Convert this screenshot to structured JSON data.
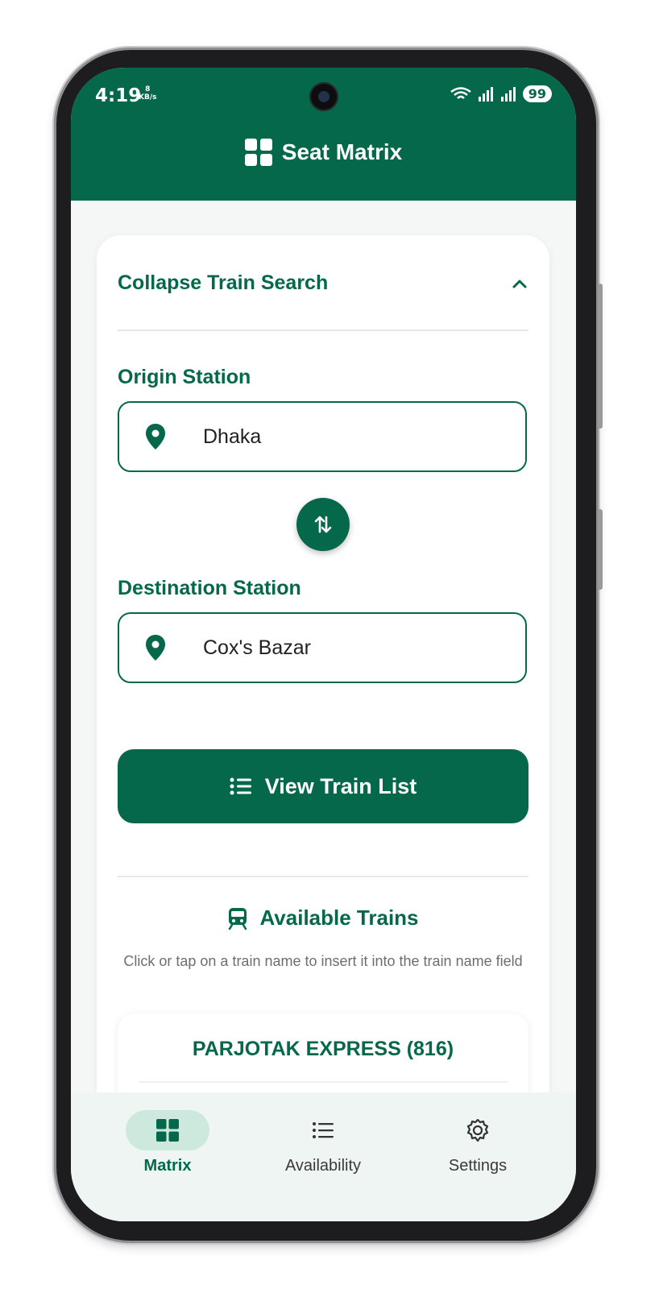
{
  "status_bar": {
    "time": "4:19",
    "speed_value": "8",
    "speed_unit": "KB/s",
    "battery": "99"
  },
  "app": {
    "title": "Seat Matrix"
  },
  "search": {
    "collapse_label": "Collapse Train Search",
    "origin_label": "Origin Station",
    "origin_value": "Dhaka",
    "destination_label": "Destination Station",
    "destination_value": "Cox's Bazar",
    "view_button": "View Train List"
  },
  "available": {
    "title": "Available Trains",
    "hint": "Click or tap on a train name to insert it into the train name field",
    "trains": [
      {
        "name": "PARJOTAK EXPRESS (816)"
      }
    ]
  },
  "bottom_nav": [
    {
      "label": "Matrix",
      "icon": "grid-icon",
      "active": true
    },
    {
      "label": "Availability",
      "icon": "list-icon",
      "active": false
    },
    {
      "label": "Settings",
      "icon": "gear-icon",
      "active": false
    }
  ],
  "colors": {
    "primary": "#05684a",
    "nav_bg": "#eff5f2",
    "active_pill": "#cde8dc"
  }
}
